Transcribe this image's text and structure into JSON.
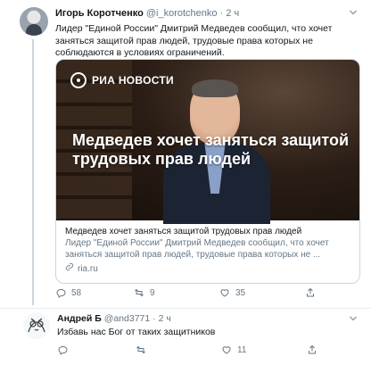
{
  "main_tweet": {
    "author": "Игорь Коротченко",
    "handle": "@i_korotchenko",
    "separator": "·",
    "time": "2 ч",
    "text": "Лидер \"Единой России\" Дмитрий Медведев сообщил, что хочет заняться защитой прав людей, трудовые права которых не соблюдаются в условиях ограничений.",
    "card": {
      "logo_text": "РИА НОВОСТИ",
      "image_headline": "Медведев хочет заняться защитой трудовых прав людей",
      "title": "Медведев хочет заняться защитой трудовых прав людей",
      "description": "Лидер \"Единой России\" Дмитрий Медведев сообщил, что хочет заняться защитой прав людей, трудовые права которых не ...",
      "domain": "ria.ru"
    },
    "actions": {
      "replies": "58",
      "retweets": "9",
      "likes": "35"
    }
  },
  "reply_tweet": {
    "author": "Андрей Б",
    "handle": "@and3771",
    "separator": "·",
    "time": "2 ч",
    "text": "Избавь нас Бог от таких защитников",
    "actions": {
      "replies": "",
      "retweets": "",
      "likes": "11"
    }
  },
  "colors": {
    "accent_gray": "#657786",
    "border": "#ccd6dd",
    "text": "#14171a"
  },
  "icons": [
    "reply-icon",
    "retweet-icon",
    "like-icon",
    "share-icon",
    "chevron-down-icon",
    "link-icon",
    "ria-logo-icon"
  ]
}
